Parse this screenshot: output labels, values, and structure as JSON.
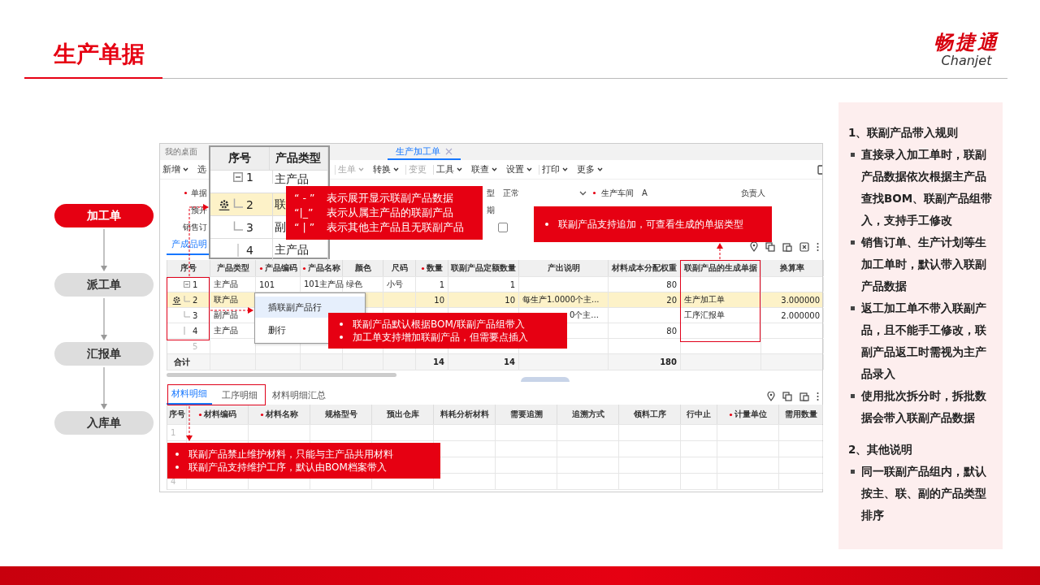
{
  "slide": {
    "title": "生产单据",
    "logo": {
      "name": "畅捷通",
      "latin": "Chanjet"
    }
  },
  "flow": [
    {
      "label": "加工单",
      "selected": true
    },
    {
      "label": "派工单",
      "selected": false
    },
    {
      "label": "汇报单",
      "selected": false
    },
    {
      "label": "入库单",
      "selected": false
    }
  ],
  "app": {
    "desktop_tab": "我的桌面",
    "tabs": [
      {
        "label": "生产加工单",
        "selected": true,
        "closable": true
      }
    ],
    "toolbar": [
      {
        "label": "新增",
        "caret": true,
        "disabled": false,
        "divider": false
      },
      {
        "label": "选",
        "caret": false,
        "disabled": false,
        "divider": false
      },
      {
        "label": "生单",
        "caret": true,
        "disabled": true,
        "divider": true
      },
      {
        "label": "转换",
        "caret": true,
        "disabled": false,
        "divider": false
      },
      {
        "label": "变更",
        "caret": false,
        "disabled": true,
        "divider": true
      },
      {
        "label": "工具",
        "caret": true,
        "disabled": false,
        "divider": true
      },
      {
        "label": "联查",
        "caret": true,
        "disabled": false,
        "divider": false
      },
      {
        "label": "设置",
        "caret": true,
        "disabled": false,
        "divider": false
      },
      {
        "label": "打印",
        "caret": true,
        "disabled": false,
        "divider": true
      },
      {
        "label": "更多",
        "caret": true,
        "disabled": false,
        "divider": false
      }
    ],
    "form_rows": [
      {
        "left": {
          "label": "单据",
          "required": true
        },
        "fields": [
          {
            "kind": "select",
            "label": "型",
            "value": "正常",
            "required": false
          },
          {
            "kind": "text",
            "label": "生产车间",
            "value": "A",
            "required": true
          },
          {
            "kind": "text",
            "label": "负责人",
            "required": false
          }
        ]
      },
      {
        "left": {
          "label": "预开",
          "required": false
        },
        "fields": [
          {
            "kind": "text",
            "label": "期",
            "required": false
          }
        ]
      },
      {
        "left": {
          "label": "销售订",
          "required": false
        },
        "fields": [
          {
            "kind": "checkbox",
            "checked": false
          }
        ]
      }
    ],
    "detail_tabs": [
      {
        "label": "产成品明",
        "selected": true
      }
    ],
    "table": {
      "columns": [
        {
          "label": "序号",
          "required": false
        },
        {
          "label": "产品类型",
          "required": false
        },
        {
          "label": "产品编码",
          "required": true
        },
        {
          "label": "产品名称",
          "required": true
        },
        {
          "label": "颜色",
          "required": false
        },
        {
          "label": "尺码",
          "required": false
        },
        {
          "label": "数量",
          "required": true
        },
        {
          "label": "联副产品定额数量",
          "required": false
        },
        {
          "label": "产出说明",
          "required": false
        },
        {
          "label": "材料成本分配权重",
          "required": false
        },
        {
          "label": "联副产品的生成单据",
          "required": false
        },
        {
          "label": "换算率",
          "required": false
        }
      ],
      "rows": [
        {
          "no": "1",
          "kind": "expanded",
          "selected": false,
          "type": "主产品",
          "code": "101",
          "name": "101主产品",
          "shade": "绿色",
          "size": "小号",
          "qty": "1",
          "quota": "1",
          "weight": "80"
        },
        {
          "no": "2",
          "kind": "branch",
          "selected": true,
          "type": "联产品",
          "qty": "10",
          "quota": "10",
          "note": "每生产1.0000个主...",
          "weight": "20",
          "doc": "生产加工单",
          "rate": "3.000000"
        },
        {
          "no": "3",
          "kind": "branch",
          "selected": false,
          "type": "副产品",
          "note": "0个主...",
          "doc": "工序汇报单",
          "rate": "2.000000"
        },
        {
          "no": "4",
          "kind": "line",
          "selected": false,
          "type": "主产品",
          "weight": "80"
        },
        {
          "no": "5",
          "kind": "blank",
          "selected": false
        }
      ],
      "summary": {
        "label": "合计",
        "qty": "14",
        "quota": "14",
        "weight": "180"
      }
    },
    "material_tabs": [
      {
        "label": "材料明细",
        "selected": true
      },
      {
        "label": "工序明细",
        "selected": false
      },
      {
        "label": "材料明细汇总",
        "selected": false
      }
    ],
    "material_table": {
      "columns": [
        {
          "label": "序号",
          "required": false
        },
        {
          "label": "材料编码",
          "required": true
        },
        {
          "label": "材料名称",
          "required": true
        },
        {
          "label": "规格型号",
          "required": false
        },
        {
          "label": "预出仓库",
          "required": false
        },
        {
          "label": "料耗分析材料",
          "required": false
        },
        {
          "label": "需要追溯",
          "required": false
        },
        {
          "label": "追溯方式",
          "required": false
        },
        {
          "label": "领料工序",
          "required": false
        },
        {
          "label": "行中止",
          "required": false
        },
        {
          "label": "计量单位",
          "required": true
        },
        {
          "label": "需用数量",
          "required": false
        }
      ],
      "rows": [
        {
          "no": "1"
        },
        {},
        {},
        {
          "no": "4"
        }
      ]
    }
  },
  "zoom_popup": {
    "columns": [
      "序号",
      "产品类型"
    ],
    "rows": [
      {
        "no": "1",
        "kind": "expanded",
        "type": "主产品",
        "selected": false
      },
      {
        "no": "2",
        "kind": "branch",
        "type": "联",
        "selected": true
      },
      {
        "no": "3",
        "kind": "branch",
        "type": "副",
        "selected": false
      },
      {
        "no": "4",
        "kind": "line",
        "type": "主产品",
        "selected": false
      }
    ]
  },
  "legend_callout": [
    {
      "symbol": "“ - ”",
      "text": "表示展开显示联副产品数据"
    },
    {
      "symbol": "“|_”",
      "text": "表示从属主产品的联副产品"
    },
    {
      "symbol": "“ | ”",
      "text": "表示其他主产品且无联副产品"
    }
  ],
  "doc_type_callout": [
    "联副产品支持追加，可查看生成的单据类型"
  ],
  "context_menu": [
    {
      "label": "插联副产品行",
      "selected": true
    },
    {
      "label": "删行",
      "selected": false
    }
  ],
  "insert_callout": [
    "联副产品默认根据BOM/联副产品组带入",
    "加工单支持增加联副产品，但需要点插入"
  ],
  "material_callout": [
    "联副产品禁止维护材料，只能与主产品共用材料",
    "联副产品支持维护工序，默认由BOM档案带入"
  ],
  "notes": [
    {
      "title": "1、联副产品带入规则",
      "items": [
        "直接录入加工单时，联副产品数据依次根据主产品查找BOM、联副产品组带入，支持手工修改",
        "销售订单、生产计划等生加工单时，默认带入联副产品数据",
        "返工加工单不带入联副产品，且不能手工修改，联副产品返工时需视为主产品录入",
        "使用批次拆分时，拆批数据会带入联副产品数据"
      ]
    },
    {
      "title": "2、其他说明",
      "items": [
        "同一联副产品组内，默认按主、联、副的产品类型排序"
      ]
    }
  ]
}
